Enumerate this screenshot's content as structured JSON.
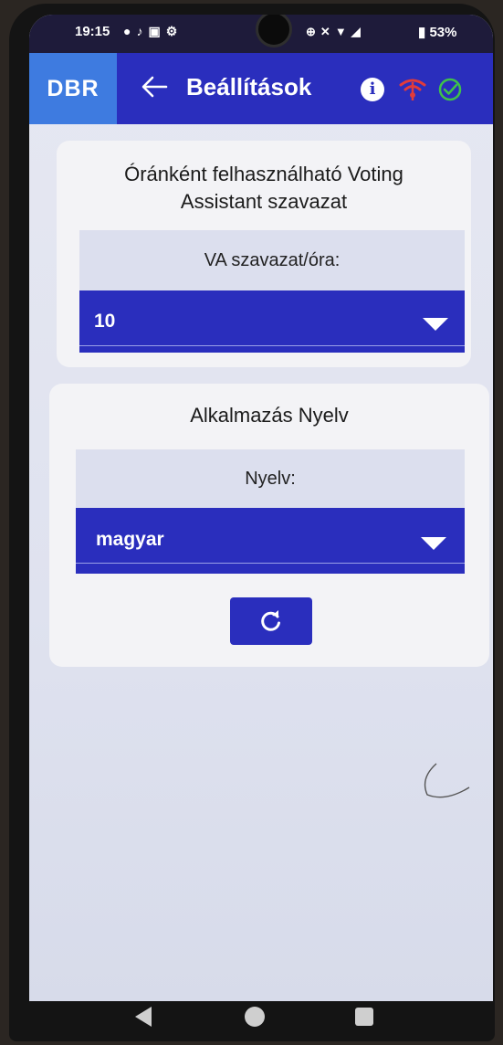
{
  "status_bar": {
    "time": "19:15",
    "left_icons": [
      "message-icon",
      "tiktok-icon",
      "youtube-icon",
      "settings-icon"
    ],
    "right_icons": [
      "data-saver-icon",
      "mute-icon",
      "wifi-icon",
      "signal-icon",
      "battery-icon"
    ],
    "battery": "53%"
  },
  "app_bar": {
    "logo": "DBR",
    "title": "Beállítások",
    "accent": "#2a2ebd",
    "logo_bg": "#3e7be0"
  },
  "votes_card": {
    "title": "Óránként felhasználható Voting Assistant szavazat",
    "label": "VA szavazat/óra:",
    "selected": "10"
  },
  "language_card": {
    "title": "Alkalmazás Nyelv",
    "label": "Nyelv:",
    "selected": "magyar"
  },
  "refresh": {
    "icon": "refresh-icon"
  },
  "nav_bar": [
    "back-triangle-icon",
    "home-circle-icon",
    "recents-square-icon"
  ]
}
